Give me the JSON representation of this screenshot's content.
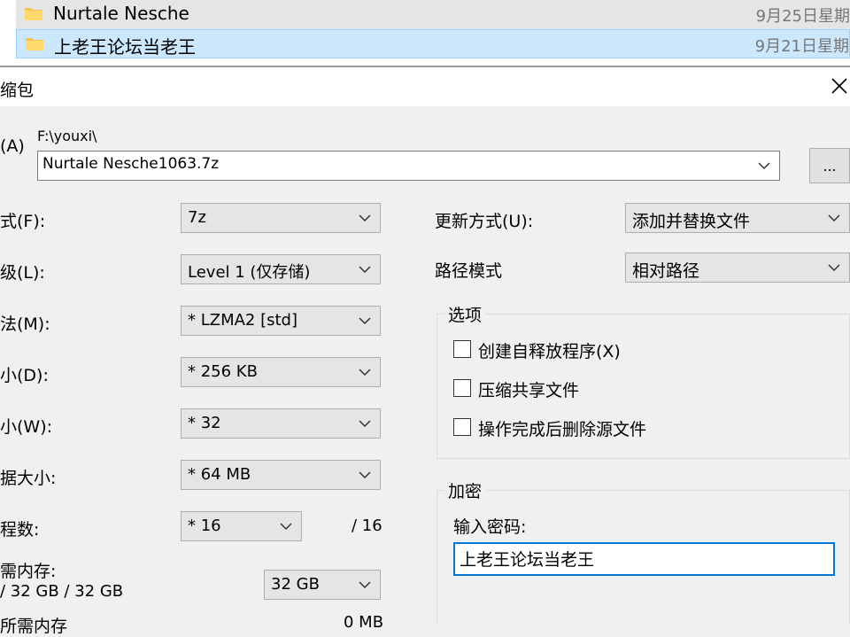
{
  "explorer": {
    "rows": [
      {
        "name": "Nurtale Nesche",
        "date": "9月25日星期"
      },
      {
        "name": "上老王论坛当老王",
        "date": "9月21日星期"
      }
    ]
  },
  "dialog": {
    "title": "缩包",
    "archive_label": "(A)",
    "path": "F:\\youxi\\",
    "archive_name": "Nurtale Nesche1063.7z",
    "browse_label": "...",
    "left": {
      "format": {
        "label": "式(F):",
        "value": "7z"
      },
      "level": {
        "label": "级(L):",
        "value": "Level 1 (仅存储)"
      },
      "method": {
        "label": "法(M):",
        "value": "* LZMA2 [std]"
      },
      "dict": {
        "label": "小(D):",
        "value": "* 256 KB"
      },
      "word": {
        "label": "小(W):",
        "value": "* 32"
      },
      "solid": {
        "label": "据大小:",
        "value": "* 64 MB"
      },
      "threads": {
        "label": "程数:",
        "value": "* 16",
        "max": "/ 16"
      },
      "memory": {
        "label": "需内存:",
        "value": "/ 32 GB / 32 GB",
        "select": "32 GB"
      },
      "cut": {
        "label": "所需内存",
        "value": "0 MB"
      }
    },
    "right": {
      "update": {
        "label": "更新方式(U):",
        "value": "添加并替换文件"
      },
      "pathmode": {
        "label": "路径模式",
        "value": "相对路径"
      },
      "options": {
        "title": "选项",
        "items": [
          "创建自释放程序(X)",
          "压缩共享文件",
          "操作完成后删除源文件"
        ]
      },
      "encryption": {
        "title": "加密",
        "password_label": "输入密码:",
        "password_value": "上老王论坛当老王"
      }
    }
  }
}
